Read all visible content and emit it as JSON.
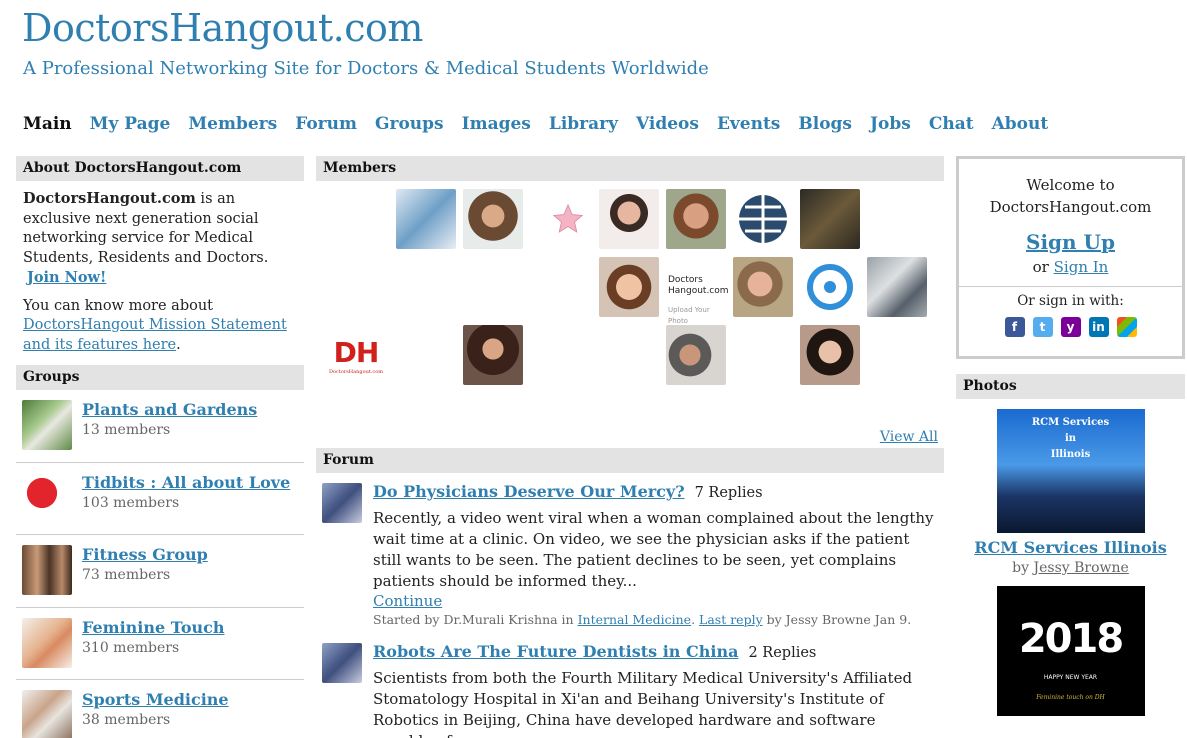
{
  "header": {
    "title": "DoctorsHangout.com",
    "tagline": "A Professional Networking Site for Doctors & Medical Students Worldwide"
  },
  "nav": [
    "Main",
    "My Page",
    "Members",
    "Forum",
    "Groups",
    "Images",
    "Library",
    "Videos",
    "Events",
    "Blogs",
    "Jobs",
    "Chat",
    "About"
  ],
  "about": {
    "heading": "About DoctorsHangout.com",
    "brand": "DoctorsHangout.com",
    "text1": " is an exclusive next generation social networking service for Medical Students, Residents and Doctors.",
    "join_label": "Join Now!",
    "text2": "You can know more about ",
    "link_label": "DoctorsHangout Mission Statement and its features here",
    "text2_end": "."
  },
  "groups": {
    "heading": "Groups",
    "items": [
      {
        "name": "Plants and Gardens",
        "count": "13 members"
      },
      {
        "name": "Tidbits : All about Love",
        "count": "103 members"
      },
      {
        "name": "Fitness Group",
        "count": "73 members"
      },
      {
        "name": "Feminine Touch",
        "count": "310 members"
      },
      {
        "name": "Sports Medicine",
        "count": "38 members"
      }
    ]
  },
  "members": {
    "heading": "Members",
    "view_all": "View All",
    "dh_logo_text": "DH",
    "dh_logo_sub": "DoctorsHangout.com",
    "dh_placeholder": "Doctors Hangout.com",
    "dh_placeholder_sub": "Upload Your Photo"
  },
  "forum": {
    "heading": "Forum",
    "posts": [
      {
        "title": "Do Physicians Deserve Our Mercy?",
        "replies": "7 Replies",
        "excerpt": "Recently, a video went viral when a woman complained about the lengthy wait time at a clinic. On video, we see the physician asks if the patient still wants to be seen. The patient declines to be seen, yet complains patients should be informed they...",
        "continue": "Continue",
        "meta_start": "Started by Dr.Murali Krishna in ",
        "category": "Internal Medicine",
        "meta_mid": ". ",
        "last_reply": "Last reply",
        "meta_end": " by Jessy Browne Jan 9."
      },
      {
        "title": "Robots Are The Future Dentists in China",
        "replies": "2 Replies",
        "excerpt": "Scientists from both the Fourth Military Medical University's Affiliated Stomatology Hospital in Xi'an and Beihang University's Institute of Robotics in Beijing, China have developed hardware and software capable of"
      }
    ]
  },
  "welcome": {
    "line1": "Welcome to",
    "line2": "DoctorsHangout.com",
    "signup": "Sign Up",
    "or": "or ",
    "signin": "Sign In",
    "or_sign_with": "Or sign in with:"
  },
  "photos": {
    "heading": "Photos",
    "items": [
      {
        "caption": "RCM Services Illinois",
        "by_prefix": "by ",
        "author": "Jessy Browne",
        "img_text1": "RCM Services",
        "img_text2": "in",
        "img_text3": "Illinois"
      },
      {
        "img_year": "2018",
        "img_line": "HAPPY NEW YEAR",
        "img_foot": "Feminine touch on DH"
      }
    ]
  }
}
